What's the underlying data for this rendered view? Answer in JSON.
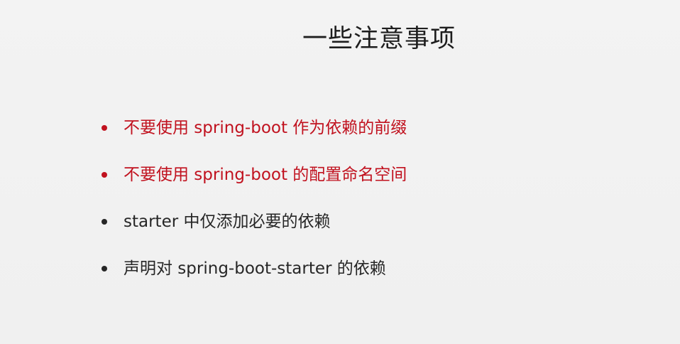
{
  "slide": {
    "title": "一些注意事项",
    "colors": {
      "warning": "#c1121f",
      "normal": "#262626"
    },
    "bullets": [
      {
        "text": "不要使用 spring-boot 作为依赖的前缀",
        "color": "#c1121f"
      },
      {
        "text": "不要使用 spring-boot 的配置命名空间",
        "color": "#c1121f"
      },
      {
        "text": "starter 中仅添加必要的依赖",
        "color": "#262626"
      },
      {
        "text": "声明对 spring-boot-starter 的依赖",
        "color": "#262626"
      }
    ]
  }
}
